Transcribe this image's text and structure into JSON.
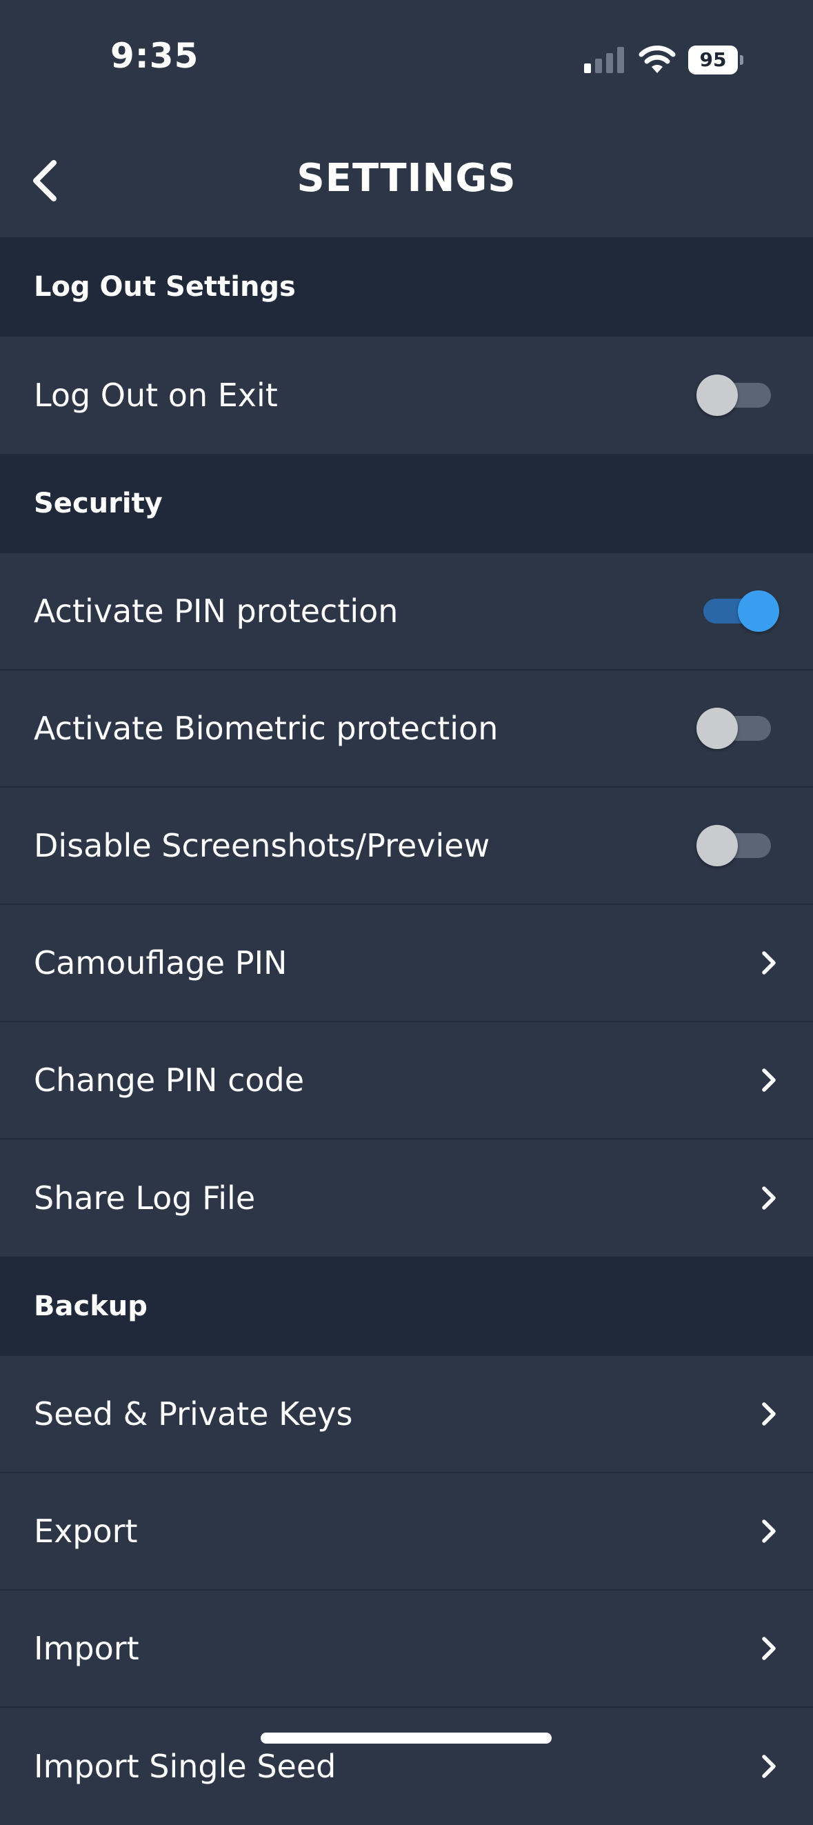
{
  "status_bar": {
    "time": "9:35",
    "battery_level": "95",
    "icons": [
      "cellular-signal-icon",
      "wifi-icon",
      "battery-icon"
    ]
  },
  "header": {
    "title": "SETTINGS",
    "back_icon": "chevron-left-icon"
  },
  "sections": {
    "logout": {
      "header": "Log Out Settings",
      "rows": [
        {
          "label": "Log Out on Exit",
          "toggle": false
        }
      ]
    },
    "security": {
      "header": "Security",
      "rows": [
        {
          "label": "Activate PIN protection",
          "toggle": true
        },
        {
          "label": "Activate Biometric protection",
          "toggle": false
        },
        {
          "label": "Disable Screenshots/Preview",
          "toggle": false
        },
        {
          "label": "Camouflage PIN"
        },
        {
          "label": "Change PIN code"
        },
        {
          "label": "Share Log File"
        }
      ]
    },
    "backup": {
      "header": "Backup",
      "rows": [
        {
          "label": "Seed & Private Keys"
        },
        {
          "label": "Export"
        },
        {
          "label": "Import"
        },
        {
          "label": "Import Single Seed"
        }
      ]
    }
  },
  "colors": {
    "background": "#2d3647",
    "section_header": "#1f293a",
    "accent": "#3a9ef0",
    "toggle_off_track": "#5c6575"
  }
}
